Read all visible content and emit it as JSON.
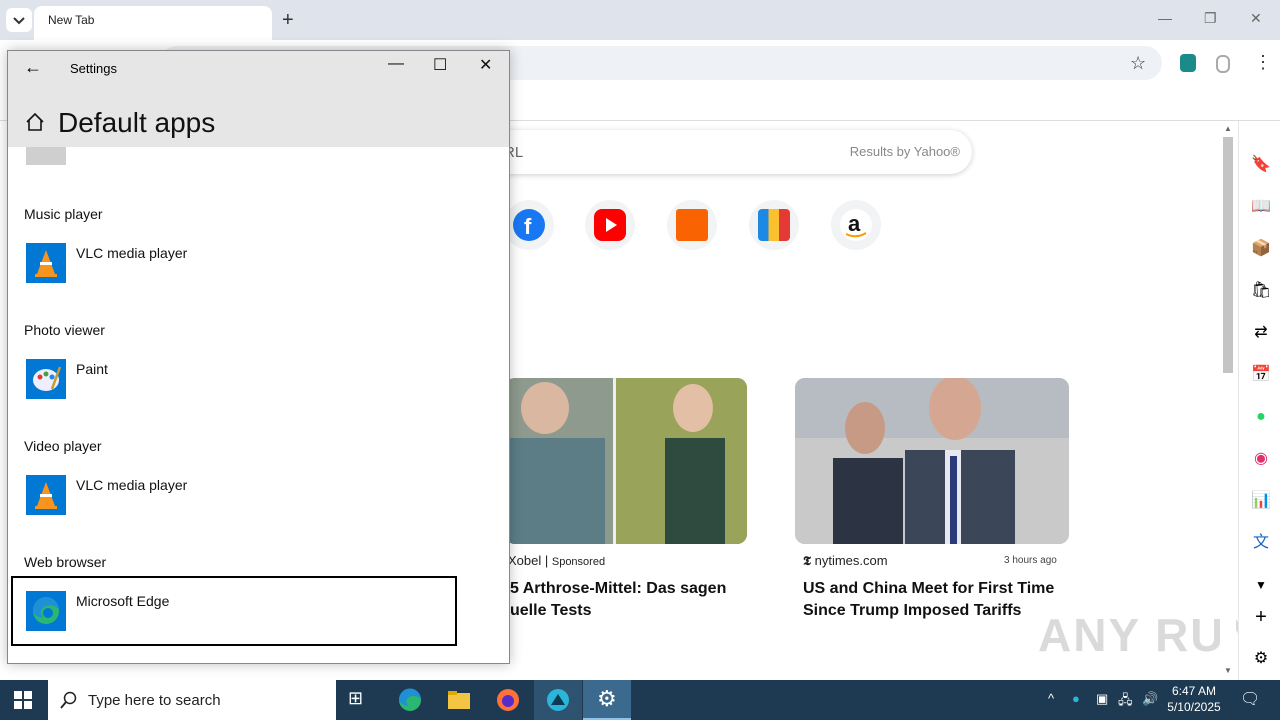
{
  "browser": {
    "tab_title": "New Tab",
    "search_placeholder": "RL",
    "search_provider": "Results by Yahoo®",
    "minimize": "—",
    "restore": "❐",
    "close": "✕"
  },
  "news": [
    {
      "source": "Xobel",
      "tag": "Sponsored",
      "headline_line1": "5 Arthrose-Mittel: Das sagen",
      "headline_line2": "uelle Tests"
    },
    {
      "source": "nytimes.com",
      "time": "3 hours ago",
      "headline_line1": "US and China Meet for First Time",
      "headline_line2": "Since Trump Imposed Tariffs"
    }
  ],
  "watermark": "ANY RUN",
  "settings": {
    "window_title": "Settings",
    "page_title": "Default apps",
    "categories": [
      {
        "label": "Music player",
        "app": "VLC media player",
        "icon": "vlc-icon"
      },
      {
        "label": "Photo viewer",
        "app": "Paint",
        "icon": "paint-icon"
      },
      {
        "label": "Video player",
        "app": "VLC media player",
        "icon": "vlc-icon"
      },
      {
        "label": "Web browser",
        "app": "Microsoft Edge",
        "icon": "edge-icon"
      }
    ]
  },
  "taskbar": {
    "search_placeholder": "Type here to search",
    "time": "6:47 AM",
    "date": "5/10/2025"
  },
  "colors": {
    "taskbar": "#1d3a52",
    "accent": "#0078d4",
    "edge_blue": "#1f8fd6"
  }
}
